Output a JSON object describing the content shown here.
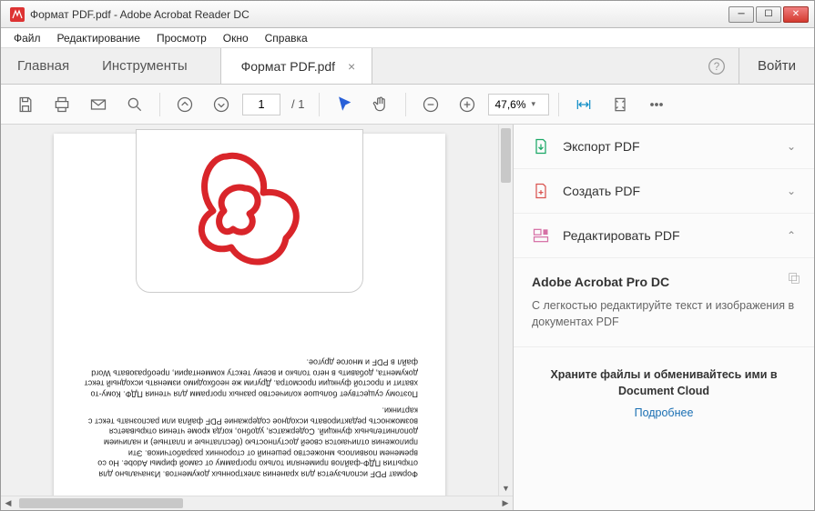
{
  "window": {
    "title": "Формат PDF.pdf - Adobe Acrobat Reader DC"
  },
  "menu": {
    "file": "Файл",
    "edit": "Редактирование",
    "view": "Просмотр",
    "window": "Окно",
    "help": "Справка"
  },
  "tabs": {
    "home": "Главная",
    "tools": "Инструменты",
    "doc": "Формат PDF.pdf",
    "login": "Войти"
  },
  "toolbar": {
    "page_current": "1",
    "page_total": "/ 1",
    "zoom": "47,6%"
  },
  "document": {
    "para1": "Формат PDF используется для хранения электронных документов. Изначально для открытия ПДФ-файлов применяли только программу от самой фирмы Adobe. Но со временем появилось множество решений от сторонних разработчиков. Эти приложения отличаются своей доступностью (бесплатные и платные) и наличием дополнительных функций. Содержатся, удобно, когда кроме чтения открывается возможность редактировать исходное содержание PDF файла или распознать текст с картинки.",
    "para2": "Поэтому существует большое количество разных программ для чтения ПДФ. Кому-то хватит и простой функции просмотра. Другим же необходимо изменять исходный текст документа, добавить в него только и всему тексту комментарии, преобразовать Word файл в PDF и многое другое."
  },
  "sidepanel": {
    "export": "Экспорт PDF",
    "create": "Создать PDF",
    "edit": "Редактировать PDF",
    "promo_title": "Adobe Acrobat Pro DC",
    "promo_text": "С легкостью редактируйте текст и изображения в документах PDF",
    "cloud_text": "Храните файлы и обменивайтесь ими в Document Cloud",
    "cloud_link": "Подробнее"
  }
}
